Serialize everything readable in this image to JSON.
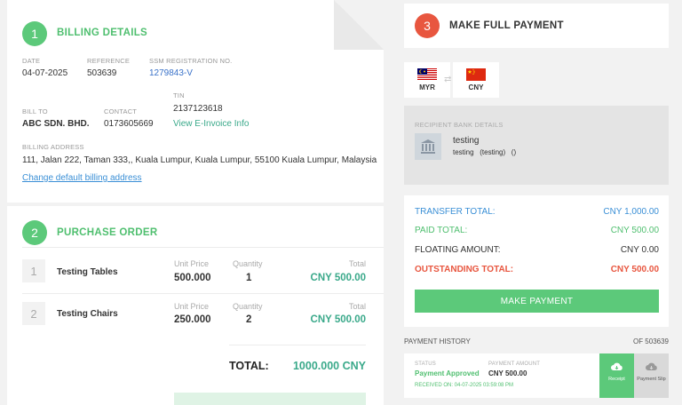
{
  "billing": {
    "step": "1",
    "title": "BILLING DETAILS",
    "date_label": "DATE",
    "date": "04-07-2025",
    "reference_label": "REFERENCE",
    "reference": "503639",
    "ssm_label": "SSM REGISTRATION NO.",
    "ssm": "1279843-V",
    "tin_label": "TIN",
    "tin": "2137123618",
    "bill_to_label": "BILL TO",
    "bill_to": "ABC SDN. BHD.",
    "contact_label": "CONTACT",
    "contact": "0173605669",
    "einvoice_link": "View E-Invoice Info",
    "address_label": "BILLING ADDRESS",
    "address": "111, Jalan 222, Taman 333,, Kuala Lumpur, Kuala Lumpur, 55100 Kuala Lumpur, Malaysia",
    "change_link": "Change default billing address"
  },
  "purchase": {
    "step": "2",
    "title": "PURCHASE ORDER",
    "unit_price_label": "Unit Price",
    "quantity_label": "Quantity",
    "total_label": "Total",
    "items": [
      {
        "index": "1",
        "name": "Testing Tables",
        "unit_price": "500.000",
        "quantity": "1",
        "total": "CNY 500.00"
      },
      {
        "index": "2",
        "name": "Testing Chairs",
        "unit_price": "250.000",
        "quantity": "2",
        "total": "CNY 500.00"
      }
    ],
    "grand_total_label": "TOTAL:",
    "grand_total": "1000.000 CNY"
  },
  "payment": {
    "step": "3",
    "title": "MAKE FULL PAYMENT",
    "from_currency": "MYR",
    "to_currency": "CNY",
    "bank_label": "RECIPIENT BANK DETAILS",
    "bank_name": "testing",
    "bank_detail": "testing   (testing)   ()",
    "transfer_total_label": "TRANSFER TOTAL:",
    "transfer_total": "CNY 1,000.00",
    "paid_total_label": "PAID TOTAL:",
    "paid_total": "CNY 500.00",
    "floating_label": "FLOATING AMOUNT:",
    "floating": "CNY 0.00",
    "outstanding_label": "OUTSTANDING TOTAL:",
    "outstanding": "CNY 500.00",
    "make_payment_button": "MAKE PAYMENT"
  },
  "history": {
    "title": "PAYMENT HISTORY",
    "ref": "OF 503639",
    "status_label": "STATUS",
    "status": "Payment Approved",
    "amount_label": "PAYMENT AMOUNT",
    "amount": "CNY 500.00",
    "received": "RECEIVED ON: 04-07-2025 03:59:08 PM",
    "receipt_button": "Receipt",
    "payment_slip_button": "Payment Slip"
  },
  "colors": {
    "green": "#5cc97a",
    "red": "#e8563f",
    "blue": "#3a8fd6",
    "outstanding_red": "#e8563f"
  },
  "icons": [
    "bank-icon",
    "transfer-arrows-icon",
    "cloud-download-icon"
  ]
}
